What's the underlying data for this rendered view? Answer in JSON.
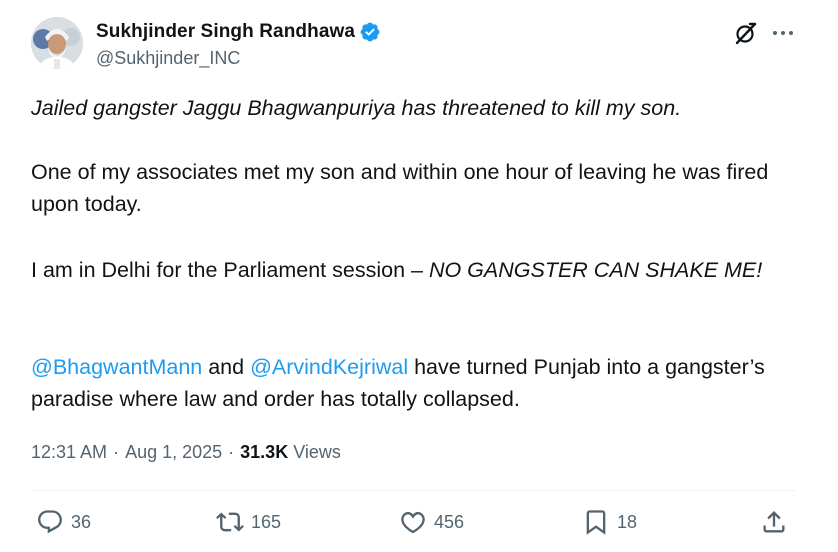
{
  "author": {
    "display_name": "Sukhjinder Singh Randhawa",
    "handle": "@Sukhjinder_INC",
    "verified": true,
    "verified_color": "#1d9bf0"
  },
  "tweet": {
    "line1": "Jailed gangster Jaggu Bhagwanpuriya has threatened to kill my son.",
    "para2": "One of my associates met my son and within one hour of leaving he was fired upon today.",
    "para3_normal": "I am in Delhi for the Parliament session – ",
    "para3_italic": "NO GANGSTER CAN SHAKE ME!",
    "mention1": "@BhagwantMann",
    "and_text": " and ",
    "mention2": "@ArvindKejriwal",
    "para4_rest": " have turned Punjab into a gangster’s paradise where law and order has totally collapsed."
  },
  "meta": {
    "time": "12:31 AM",
    "separator": "·",
    "date": "Aug 1, 2025",
    "views_count": "31.3K",
    "views_label": "Views"
  },
  "actions": {
    "replies": "36",
    "reposts": "165",
    "likes": "456",
    "bookmarks": "18"
  },
  "icons": {
    "grok": "grok-icon",
    "more": "more-icon",
    "reply": "reply-icon",
    "repost": "repost-icon",
    "like": "heart-icon",
    "bookmark": "bookmark-icon",
    "share": "share-icon"
  },
  "colors": {
    "text": "#0f1419",
    "secondary": "#536471",
    "link": "#1d9bf0",
    "divider": "#eff3f4"
  }
}
